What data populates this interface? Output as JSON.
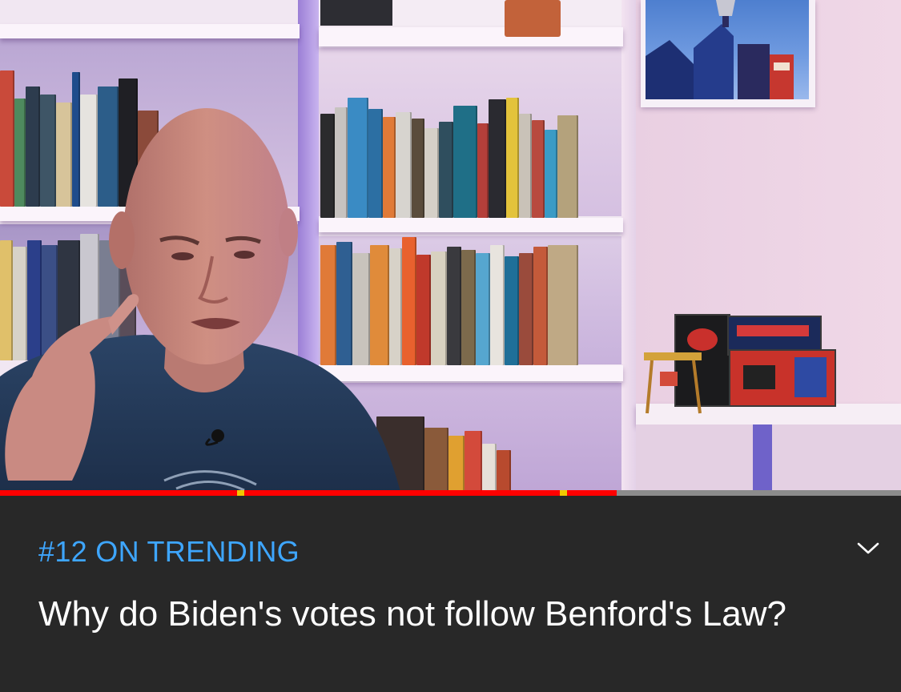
{
  "video": {
    "progress_percent": 68.4,
    "chapter_marks_percent": [
      26.3,
      62.1
    ]
  },
  "info": {
    "trending_label": "#12 ON TRENDING",
    "title": "Why do Biden's votes not follow Benford's Law?",
    "expand_icon": "chevron-down-icon"
  },
  "colors": {
    "trending": "#3ea6ff",
    "progress_played": "#ff0000",
    "chapter_mark": "#f0c800",
    "panel_bg": "#282828"
  }
}
